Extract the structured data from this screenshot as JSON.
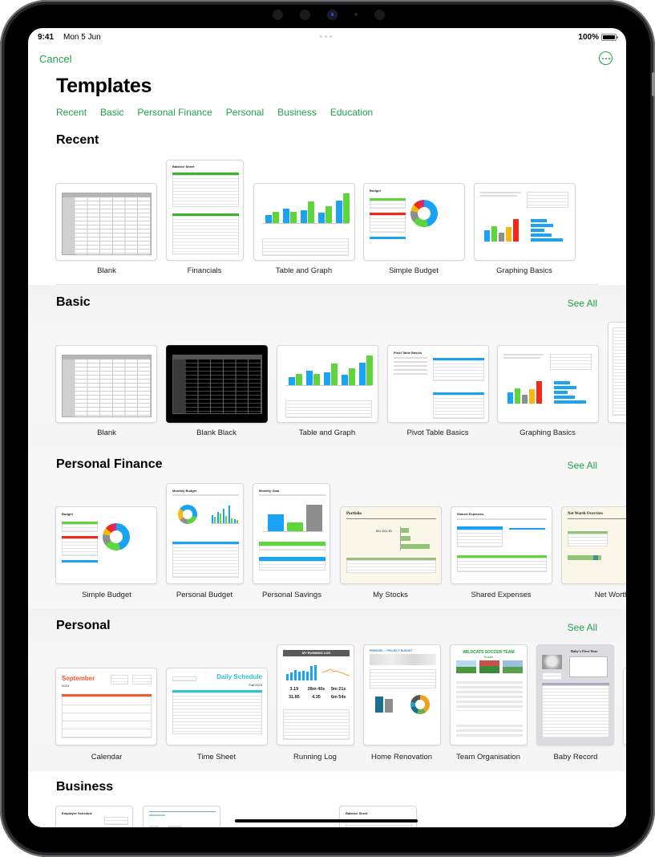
{
  "status_bar": {
    "time": "9:41",
    "date": "Mon 5 Jun",
    "battery": "100%"
  },
  "header": {
    "cancel_label": "Cancel",
    "more_icon": "ellipsis-circle-icon",
    "title": "Templates"
  },
  "nav_tabs": [
    "Recent",
    "Basic",
    "Personal Finance",
    "Personal",
    "Business",
    "Education"
  ],
  "see_all_label": "See All",
  "sections": {
    "recent": {
      "title": "Recent",
      "templates": [
        "Blank",
        "Financials",
        "Table and Graph",
        "Simple Budget",
        "Graphing Basics"
      ]
    },
    "basic": {
      "title": "Basic",
      "templates": [
        "Blank",
        "Blank Black",
        "Table and Graph",
        "Pivot Table Basics",
        "Graphing Basics"
      ]
    },
    "personal_finance": {
      "title": "Personal Finance",
      "templates": [
        "Simple Budget",
        "Personal Budget",
        "Personal Savings",
        "My Stocks",
        "Shared Expenses",
        "Net Worth"
      ]
    },
    "personal": {
      "title": "Personal",
      "templates": [
        "Calendar",
        "Time Sheet",
        "Running Log",
        "Home Renovation",
        "Team Organisation",
        "Baby Record"
      ]
    },
    "business": {
      "title": "Business"
    }
  },
  "thumbnail_text": {
    "financials": "Balance Sheet",
    "simple_budget": "Budget",
    "pivot": "Pivot Table Basics",
    "personal_budget": "Monthly Budget",
    "personal_savings": "Monthly Goal",
    "my_stocks": "Portfolio",
    "my_stocks_value": "$11,541.30",
    "shared_expenses": "Shared Expenses",
    "net_worth": "Net Worth Overview",
    "calendar_month": "September",
    "calendar_year": "2024",
    "time_sheet": "Daily Schedule",
    "time_sheet_sub": "Fall 2024",
    "running_log": "MY RUNNING LOG",
    "running_stats": [
      "3.19",
      "28m 40s",
      "9m 21s",
      "31.85",
      "4.35",
      "6m 54s"
    ],
    "home_renovation": "REMODEL – PROJECT BUDGET",
    "team": "WILDCATS SOCCER TEAM",
    "team_sub": "Roster",
    "baby": "Baby's First Year",
    "employee_schedule": "Employee Schedule",
    "balance_sheet": "Balance Sheet"
  },
  "colors": {
    "accent": "#1fa34a",
    "chart_blue": "#1aa3f5",
    "chart_green": "#5ed53a",
    "chart_red": "#f5281a",
    "chart_yellow": "#f7b911",
    "calendar_orange": "#ee5a32",
    "timesheet_teal": "#2bc3d1"
  }
}
